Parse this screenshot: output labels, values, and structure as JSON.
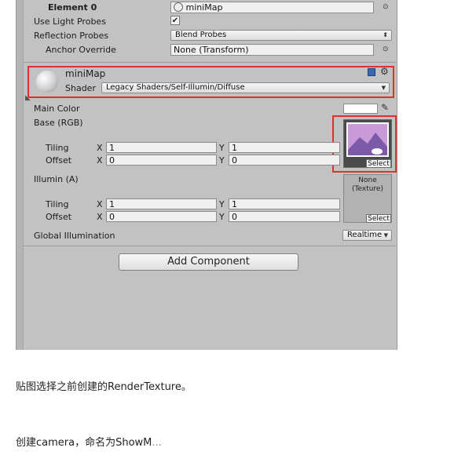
{
  "element": {
    "label": "Element 0",
    "value": "miniMap"
  },
  "rows": {
    "light_probes_label": "Use Light Probes",
    "reflection_label": "Reflection Probes",
    "reflection_value": "Blend Probes",
    "anchor_label": "Anchor Override",
    "anchor_value": "None (Transform)"
  },
  "material": {
    "name": "miniMap",
    "shader_label": "Shader",
    "shader_value": "Legacy Shaders/Self-Illumin/Diffuse"
  },
  "props": {
    "main_color_label": "Main Color",
    "base_label": "Base (RGB)",
    "illum_label": "Illumin (A)",
    "tiling_label": "Tiling",
    "offset_label": "Offset",
    "x": "X",
    "y": "Y",
    "base_tiling_x": "1",
    "base_tiling_y": "1",
    "base_offset_x": "0",
    "base_offset_y": "0",
    "illum_tiling_x": "1",
    "illum_tiling_y": "1",
    "illum_offset_x": "0",
    "illum_offset_y": "0",
    "select": "Select",
    "illum_none": "None\n(Texture)",
    "gi_label": "Global Illumination",
    "gi_value": "Realtime"
  },
  "add_component": "Add Component",
  "caption1": "贴图选择之前创建的RenderTexture。",
  "caption2": "创建camera，命名为ShowM",
  "caption2_tail": "...",
  "colors": {
    "panel": "#c2c2c2",
    "highlight": "#e03030",
    "preview_sky": "#c89ad8",
    "preview_mountain": "#7c5aa8"
  }
}
